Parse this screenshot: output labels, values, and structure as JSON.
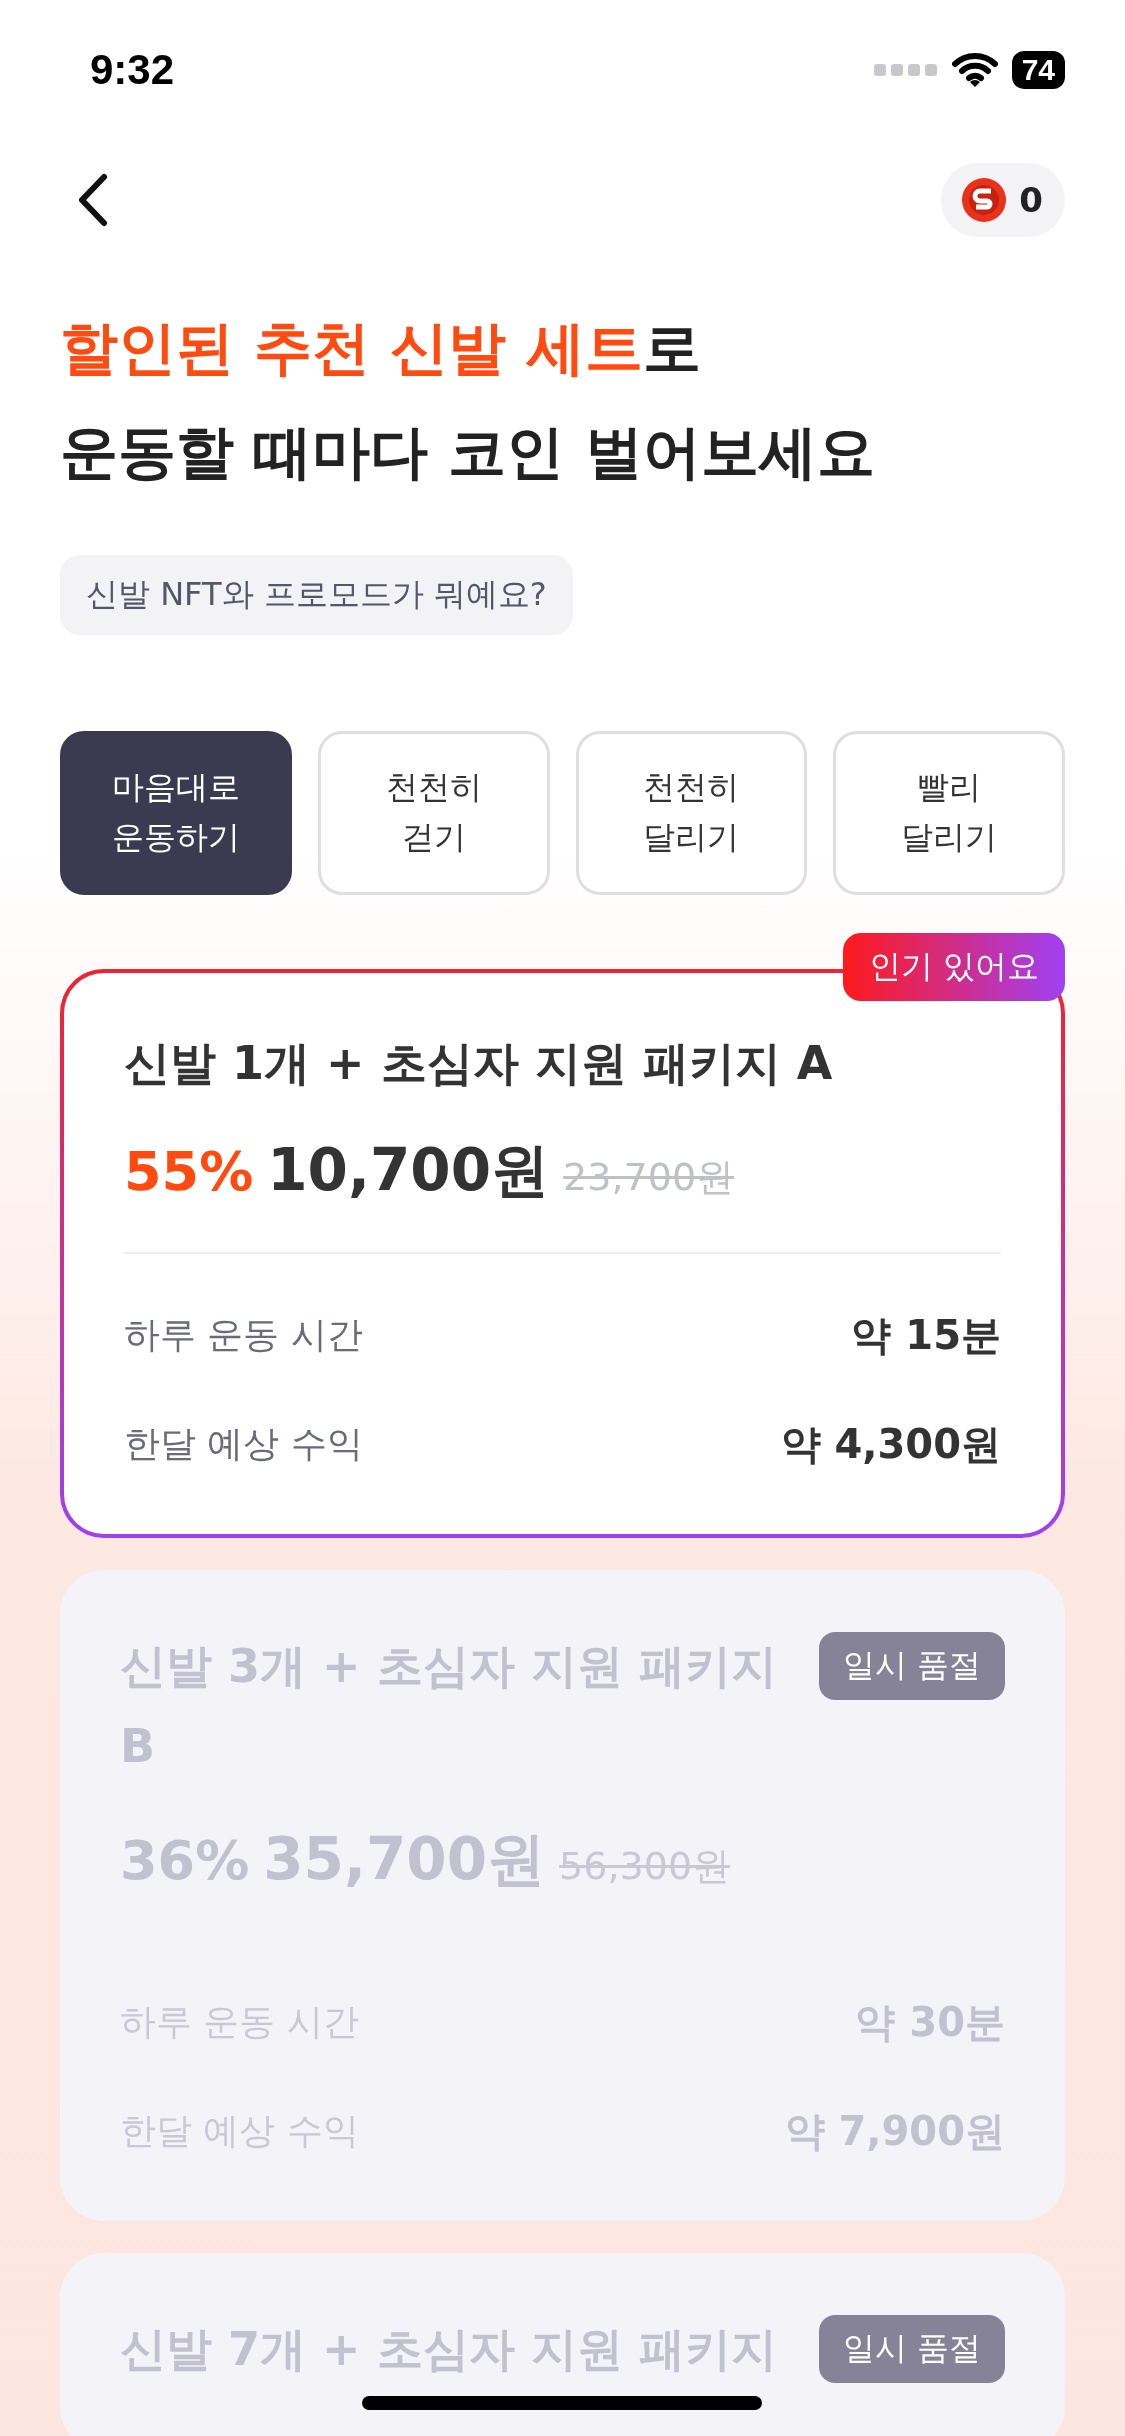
{
  "status_bar": {
    "time": "9:32",
    "battery": "74"
  },
  "header": {
    "coins": "0"
  },
  "headline": {
    "highlight": "할인된 추천 신발 세트",
    "rest": "로",
    "line2": "운동할 때마다 코인 벌어보세요"
  },
  "faq_chip": "신발 NFT와 프로모드가 뭐예요?",
  "tabs": [
    {
      "label": "마음대로\n운동하기",
      "selected": true
    },
    {
      "label": "천천히\n걷기",
      "selected": false
    },
    {
      "label": "천천히\n달리기",
      "selected": false
    },
    {
      "label": "빨리\n달리기",
      "selected": false
    }
  ],
  "packages": [
    {
      "title": "신발 1개 + 초심자 지원 패키지 A",
      "sold_out": false,
      "badge": "인기 있어요",
      "discount": "55%",
      "price": "10,700원",
      "original_price": "23,700원",
      "details": [
        {
          "label": "하루 운동 시간",
          "value": "약 15분"
        },
        {
          "label": "한달 예상 수익",
          "value": "약 4,300원"
        }
      ]
    },
    {
      "title": "신발 3개 + 초심자 지원 패키지 B",
      "sold_out": true,
      "badge": "일시 품절",
      "discount": "36%",
      "price": "35,700원",
      "original_price": "56,300원",
      "details": [
        {
          "label": "하루 운동 시간",
          "value": "약 30분"
        },
        {
          "label": "한달 예상 수익",
          "value": "약 7,900원"
        }
      ]
    },
    {
      "title": "신발 7개 + 초심자 지원 패키지",
      "sold_out": true,
      "badge": "일시 품절"
    }
  ]
}
